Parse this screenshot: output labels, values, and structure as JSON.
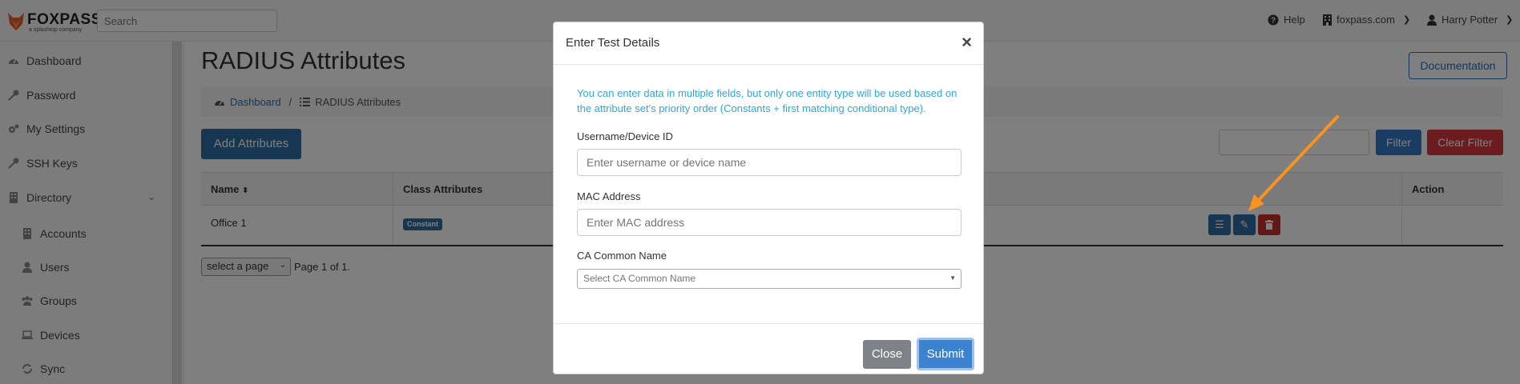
{
  "navbar": {
    "brand": "FOXPASS",
    "brand_sub": "a splashtop company",
    "search_placeholder": "Search",
    "help": "Help",
    "domain": "foxpass.com",
    "user": "Harry Potter"
  },
  "sidebar": {
    "items": [
      {
        "label": "Dashboard",
        "icon": "dashboard-icon"
      },
      {
        "label": "Password",
        "icon": "key-icon"
      },
      {
        "label": "My Settings",
        "icon": "gears-icon"
      },
      {
        "label": "SSH Keys",
        "icon": "key-icon"
      },
      {
        "label": "Directory",
        "icon": "building-icon"
      },
      {
        "label": "Accounts",
        "icon": "building-icon"
      },
      {
        "label": "Users",
        "icon": "user-icon"
      },
      {
        "label": "Groups",
        "icon": "group-icon"
      },
      {
        "label": "Devices",
        "icon": "laptop-icon"
      },
      {
        "label": "Sync",
        "icon": "sync-icon"
      }
    ]
  },
  "main": {
    "title": "RADIUS Attributes",
    "documentation_button": "Documentation",
    "breadcrumb": {
      "home": "Dashboard",
      "separator": "/",
      "current": "RADIUS Attributes"
    },
    "add_button": "Add Attributes",
    "filter_button": "Filter",
    "clear_filter_button": "Clear Filter",
    "table": {
      "headers": [
        "Name",
        "Class Attributes",
        "Action"
      ],
      "rows": [
        {
          "name": "Office 1",
          "badge": "Constant"
        }
      ]
    },
    "pager": {
      "select": "select a page",
      "text": "Page 1 of 1."
    }
  },
  "modal": {
    "title": "Enter Test Details",
    "close_symbol": "×",
    "info": "You can enter data in multiple fields, but only one entity type will be used based on the attribute set's priority order (Constants + first matching conditional type).",
    "fields": {
      "username_label": "Username/Device ID",
      "username_placeholder": "Enter username or device name",
      "mac_label": "MAC Address",
      "mac_placeholder": "Enter MAC address",
      "ca_label": "CA Common Name",
      "ca_placeholder": "Select CA Common Name"
    },
    "close_button": "Close",
    "submit_button": "Submit"
  },
  "colors": {
    "primary": "#2e6da4",
    "danger": "#d9363e",
    "info_text": "#31a6d6",
    "annotation_arrow": "#f7931e"
  }
}
